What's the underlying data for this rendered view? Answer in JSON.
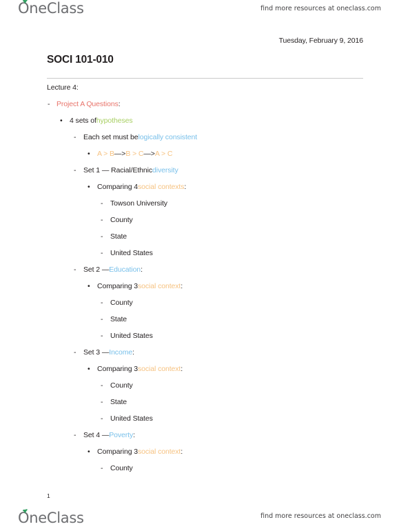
{
  "brand": {
    "logo_text": "OneClass",
    "leaf_color": "#2f9e5f",
    "resources_text": "find more resources at oneclass.com"
  },
  "document": {
    "date": "Tuesday, February 9, 2016",
    "title": "SOCI 101-010",
    "page_number": "1"
  },
  "colors": {
    "red": "#e8736a",
    "green": "#a8cf63",
    "blue": "#79c0ea",
    "orange": "#f6c281",
    "body": "#231f20",
    "rule": "#c9c9c9"
  },
  "outline": [
    {
      "level": 0,
      "marker": "",
      "parts": [
        {
          "t": "Lecture 4:",
          "c": "dark"
        }
      ]
    },
    {
      "level": 1,
      "marker": "-",
      "parts": [
        {
          "t": "Project A Questions",
          "c": "red"
        },
        {
          "t": ":",
          "c": "dark"
        }
      ]
    },
    {
      "level": 2,
      "marker": "•",
      "parts": [
        {
          "t": "4 sets of ",
          "c": "dark"
        },
        {
          "t": "hypotheses",
          "c": "green"
        }
      ]
    },
    {
      "level": 3,
      "marker": "-",
      "parts": [
        {
          "t": "Each set must be ",
          "c": "dark"
        },
        {
          "t": "logically consistent",
          "c": "blue"
        }
      ]
    },
    {
      "level": 4,
      "marker": "•",
      "parts": [
        {
          "t": "A > B ",
          "c": "orange"
        },
        {
          "t": "—>",
          "c": "dark"
        },
        {
          "t": " B > C ",
          "c": "orange"
        },
        {
          "t": "—>",
          "c": "dark"
        },
        {
          "t": " A > C",
          "c": "orange"
        }
      ]
    },
    {
      "level": 3,
      "marker": "-",
      "parts": [
        {
          "t": "Set 1  —  Racial/Ethnic ",
          "c": "dark"
        },
        {
          "t": "diversity",
          "c": "blue"
        }
      ]
    },
    {
      "level": 4,
      "marker": "•",
      "parts": [
        {
          "t": "Comparing 4 ",
          "c": "dark"
        },
        {
          "t": "social contexts",
          "c": "orange"
        },
        {
          "t": ":",
          "c": "dark"
        }
      ]
    },
    {
      "level": 5,
      "marker": "-",
      "parts": [
        {
          "t": "Towson University",
          "c": "dark"
        }
      ]
    },
    {
      "level": 5,
      "marker": "-",
      "parts": [
        {
          "t": "County",
          "c": "dark"
        }
      ]
    },
    {
      "level": 5,
      "marker": "-",
      "parts": [
        {
          "t": "State",
          "c": "dark"
        }
      ]
    },
    {
      "level": 5,
      "marker": "-",
      "parts": [
        {
          "t": "United States",
          "c": "dark"
        }
      ]
    },
    {
      "level": 3,
      "marker": "-",
      "parts": [
        {
          "t": "Set 2  —  ",
          "c": "dark"
        },
        {
          "t": "Education",
          "c": "blue"
        },
        {
          "t": ":",
          "c": "dark"
        }
      ]
    },
    {
      "level": 4,
      "marker": "•",
      "parts": [
        {
          "t": "Comparing 3 ",
          "c": "dark"
        },
        {
          "t": "social context",
          "c": "orange"
        },
        {
          "t": ":",
          "c": "dark"
        }
      ]
    },
    {
      "level": 5,
      "marker": "-",
      "parts": [
        {
          "t": "County",
          "c": "dark"
        }
      ]
    },
    {
      "level": 5,
      "marker": "-",
      "parts": [
        {
          "t": "State",
          "c": "dark"
        }
      ]
    },
    {
      "level": 5,
      "marker": "-",
      "parts": [
        {
          "t": "United States",
          "c": "dark"
        }
      ]
    },
    {
      "level": 3,
      "marker": "-",
      "parts": [
        {
          "t": "Set 3  —  ",
          "c": "dark"
        },
        {
          "t": "Income",
          "c": "blue"
        },
        {
          "t": ":",
          "c": "dark"
        }
      ]
    },
    {
      "level": 4,
      "marker": "•",
      "parts": [
        {
          "t": "Comparing 3 ",
          "c": "dark"
        },
        {
          "t": "social context",
          "c": "orange"
        },
        {
          "t": ":",
          "c": "dark"
        }
      ]
    },
    {
      "level": 5,
      "marker": "-",
      "parts": [
        {
          "t": "County",
          "c": "dark"
        }
      ]
    },
    {
      "level": 5,
      "marker": "-",
      "parts": [
        {
          "t": "State",
          "c": "dark"
        }
      ]
    },
    {
      "level": 5,
      "marker": "-",
      "parts": [
        {
          "t": "United States",
          "c": "dark"
        }
      ]
    },
    {
      "level": 3,
      "marker": "-",
      "parts": [
        {
          "t": "Set 4  —  ",
          "c": "dark"
        },
        {
          "t": "Poverty",
          "c": "blue"
        },
        {
          "t": ":",
          "c": "dark"
        }
      ]
    },
    {
      "level": 4,
      "marker": "•",
      "parts": [
        {
          "t": "Comparing 3 ",
          "c": "dark"
        },
        {
          "t": "social context",
          "c": "orange"
        },
        {
          "t": ":",
          "c": "dark"
        }
      ]
    },
    {
      "level": 5,
      "marker": "-",
      "parts": [
        {
          "t": "County",
          "c": "dark"
        }
      ]
    }
  ]
}
